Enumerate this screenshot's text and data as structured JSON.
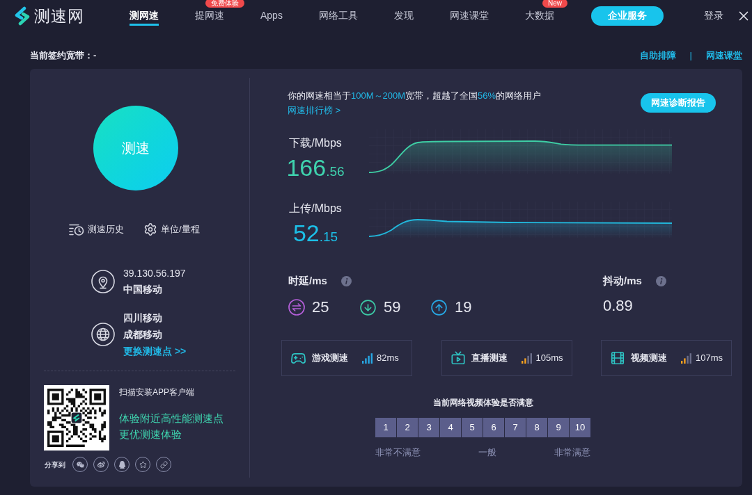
{
  "header": {
    "logo": "测速网",
    "nav": [
      {
        "label": "测网速",
        "selected": true
      },
      {
        "label": "提网速",
        "selected": false,
        "badge": "免费体验"
      },
      {
        "label": "Apps",
        "selected": false
      },
      {
        "label": "网络工具",
        "selected": false
      },
      {
        "label": "发现",
        "selected": false
      },
      {
        "label": "网速课堂",
        "selected": false
      },
      {
        "label": "大数据",
        "selected": false,
        "badge": "New"
      }
    ],
    "enterprise_button": "企业服务",
    "login": "登录"
  },
  "subheader": {
    "contract_bandwidth": "当前签约宽带：-",
    "links": [
      "自助排障",
      "网速课堂"
    ],
    "separator": "|"
  },
  "left_panel": {
    "start_button": "测速",
    "actions": [
      {
        "kind": "history",
        "label": "测速历史"
      },
      {
        "kind": "settings",
        "label": "单位/量程"
      }
    ],
    "client": {
      "ip": "39.130.56.197",
      "isp": "中国移动"
    },
    "server": {
      "region": "四川移动",
      "name": "成都移动",
      "change_link": "更换测速点 >>"
    },
    "app_promo": {
      "title": "扫描安装APP客户端",
      "lines": [
        "体验附近高性能测速点",
        "更优测速体验"
      ]
    },
    "share": {
      "label": "分享到",
      "targets": [
        {
          "kind": "wechat"
        },
        {
          "kind": "weibo"
        },
        {
          "kind": "qq"
        },
        {
          "kind": "favorite"
        },
        {
          "kind": "link"
        }
      ]
    }
  },
  "result": {
    "summary": [
      {
        "text": "你的网速相当于",
        "highlight": false
      },
      {
        "text": "100M～200M",
        "highlight": true
      },
      {
        "text": "宽带，超越了全国",
        "highlight": false
      },
      {
        "text": "56%",
        "highlight": true
      },
      {
        "text": "的网络用户",
        "highlight": false
      }
    ],
    "ranking_link": "网速排行榜 >",
    "report_button": "网速诊断报告",
    "speeds": [
      {
        "kind": "download",
        "label": "下载/Mbps",
        "integer": "166",
        "decimal": ".56"
      },
      {
        "kind": "upload",
        "label": "上传/Mbps",
        "integer": "52",
        "decimal": ".15"
      }
    ],
    "latency": {
      "label": "时延/ms",
      "values": [
        {
          "kind": "ping",
          "value": "25"
        },
        {
          "kind": "download",
          "value": "59"
        },
        {
          "kind": "upload",
          "value": "19"
        }
      ]
    },
    "jitter": {
      "label": "抖动/ms",
      "value": "0.89"
    },
    "tests": [
      {
        "kind": "game",
        "label": "游戏测速",
        "strong_signal": true,
        "value": "82ms"
      },
      {
        "kind": "live",
        "label": "直播测速",
        "strong_signal": false,
        "value": "105ms"
      },
      {
        "kind": "video",
        "label": "视频测速",
        "strong_signal": false,
        "value": "107ms"
      }
    ]
  },
  "survey": {
    "question": "当前网络视频体验是否满意",
    "options": [
      {
        "label": "1",
        "selected": false
      },
      {
        "label": "2",
        "selected": false
      },
      {
        "label": "3",
        "selected": false
      },
      {
        "label": "4",
        "selected": false
      },
      {
        "label": "5",
        "selected": false
      },
      {
        "label": "6",
        "selected": false
      },
      {
        "label": "7",
        "selected": false
      },
      {
        "label": "8",
        "selected": false
      },
      {
        "label": "9",
        "selected": false
      },
      {
        "label": "10",
        "selected": false
      }
    ],
    "scale_labels": [
      "非常不满意",
      "一般",
      "非常满意"
    ]
  }
}
